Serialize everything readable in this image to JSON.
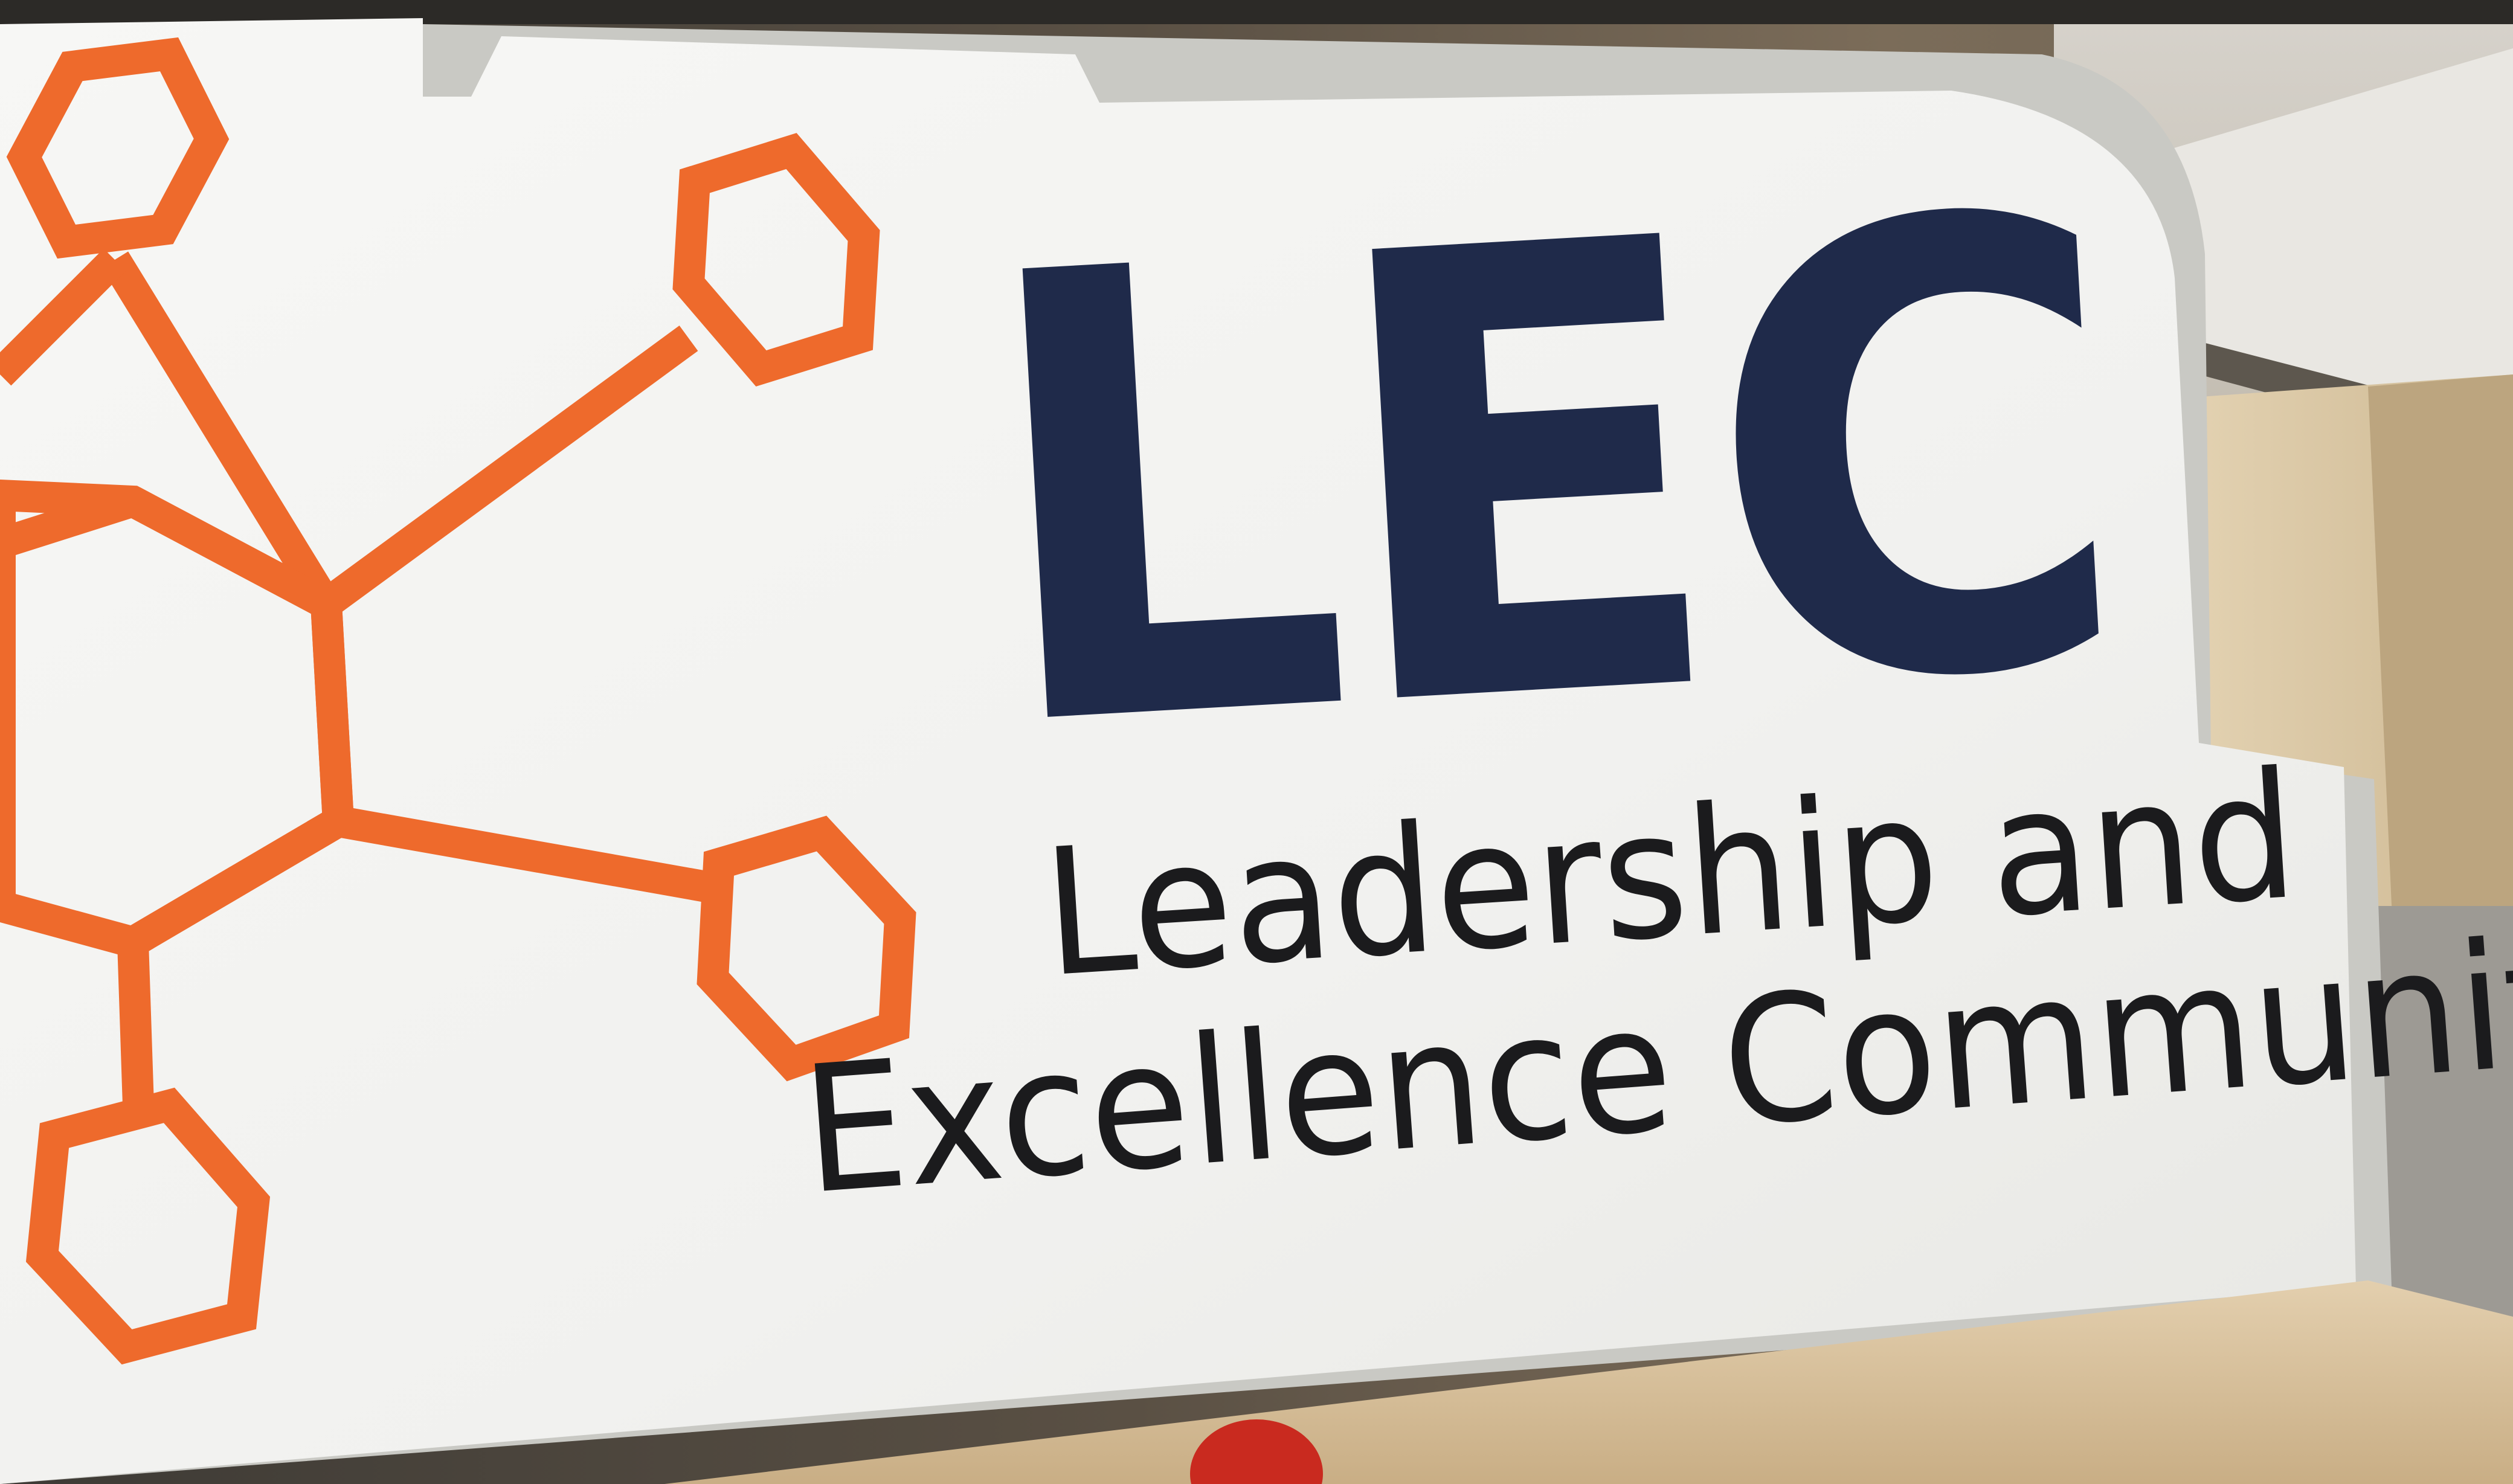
{
  "sign": {
    "logo_text": "LEC",
    "tagline_line1": "Leadership and",
    "tagline_line2": "Excellence Community"
  },
  "colors": {
    "logo_navy": "#1f2a4a",
    "tagline_black": "#1b1b1d",
    "hexagon_orange": "#ee6a2c",
    "sign_white": "#f4f4f2",
    "wood_base": "#d9c3a0"
  }
}
